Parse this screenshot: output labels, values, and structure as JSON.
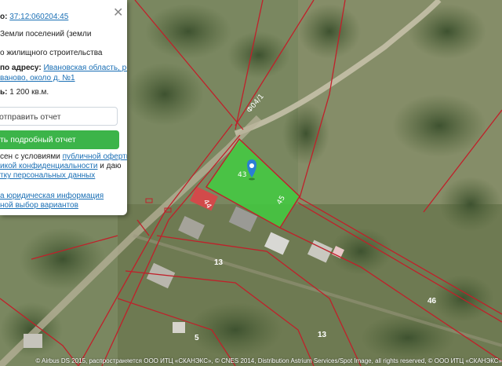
{
  "panel": {
    "cadastral_label": "о:",
    "cadastral_number": "37:12:060204:45",
    "category_line1": "Земли поселений (земли",
    "purpose": "о жилищного строительства",
    "address_label": "по адресу:",
    "address_link1": "Ивановская область, р-",
    "address_link2": "ваново, около д. №1",
    "area_label": "ь:",
    "area_value": "1 200 кв.м.",
    "send_report": "отправить отчет",
    "detailed_report": "ть подробный отчет",
    "consent_text1": "сен с условиями",
    "consent_link1": "публичной оферты",
    "consent_link2": "икой конфиденциальности",
    "consent_text2": "и даю",
    "consent_link3": "тку персональных данных",
    "footer_link1": "а юридическая информация",
    "footer_link2": "ной выбор вариантов"
  },
  "map": {
    "road_label": "Ф04/1",
    "parcel_label_43": "43",
    "parcel_label_45": "45",
    "parcel_label_44": "44",
    "parcel_13a": "13",
    "parcel_13b": "13",
    "parcel_5": "5",
    "parcel_46": "46",
    "selected_color": "#3fd13f",
    "boundary_color": "#c0202a",
    "marker_color": "#2a7fd4"
  },
  "attribution": "© Airbus DS 2015, распространяется ООО ИТЦ «СКАНЭКС», © CNES 2014, Distribution Astrium Services/Spot Image, all rights reserved, © ООО ИТЦ «СКАНЭКС»"
}
